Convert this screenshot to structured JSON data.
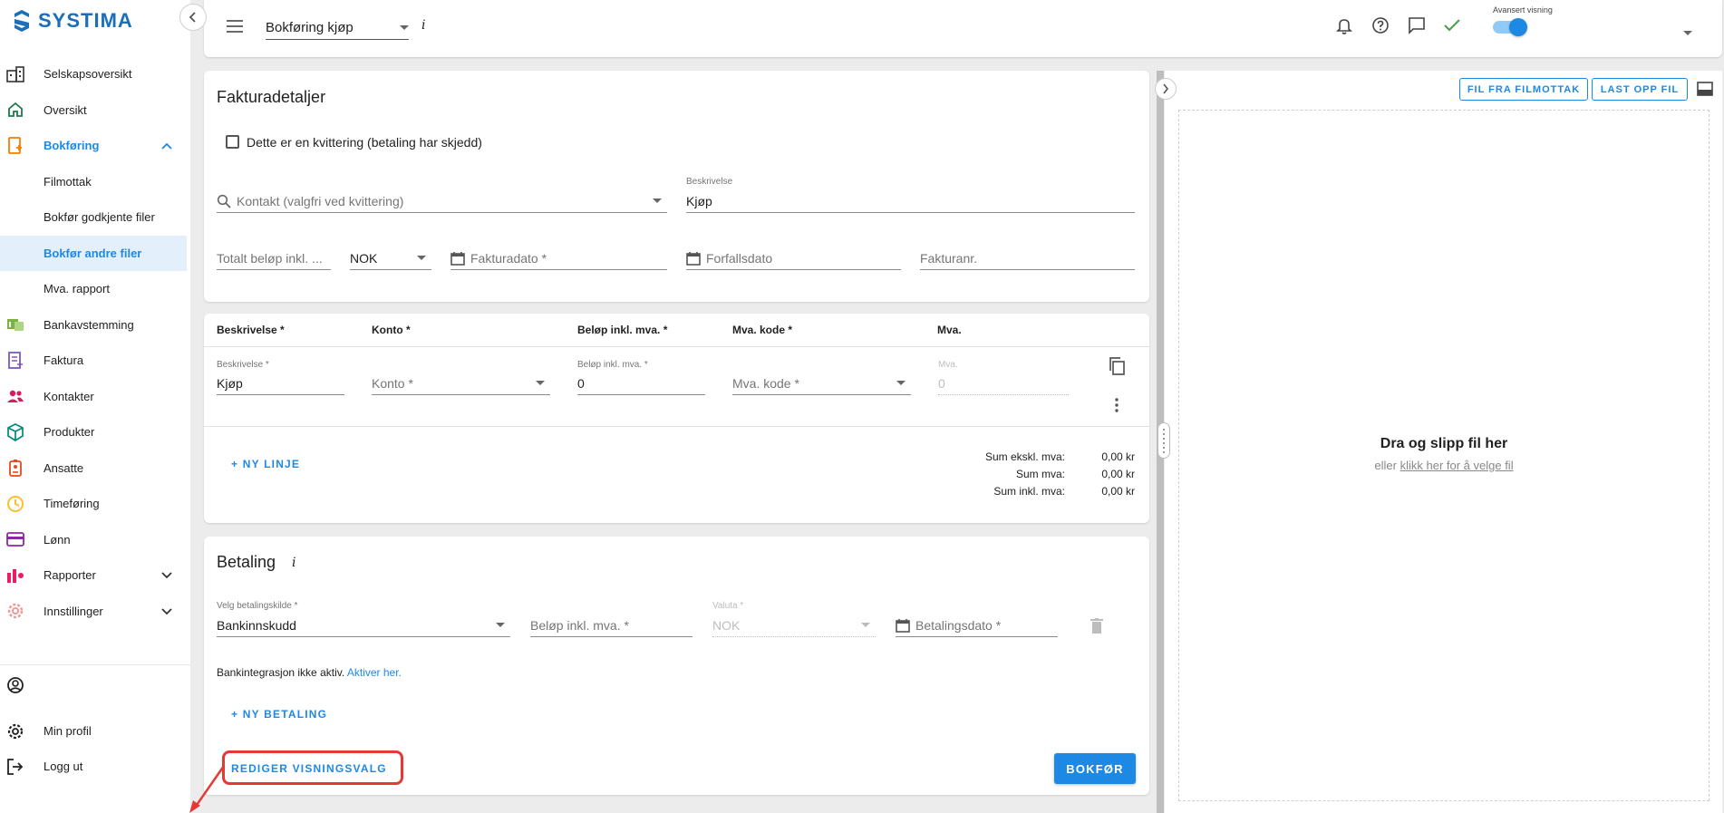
{
  "brand": {
    "name": "SYSTIMA",
    "color": "#1a6fb8"
  },
  "sidebar": {
    "items": [
      {
        "label": "Selskapsoversikt",
        "icon": "company-icon"
      },
      {
        "label": "Oversikt",
        "icon": "home-icon"
      },
      {
        "label": "Bokføring",
        "icon": "bookkeeping-icon",
        "expanded": true
      },
      {
        "label": "Filmottak"
      },
      {
        "label": "Bokfør godkjente filer"
      },
      {
        "label": "Bokfør andre filer",
        "active": true
      },
      {
        "label": "Mva. rapport"
      },
      {
        "label": "Bankavstemming",
        "icon": "bank-icon"
      },
      {
        "label": "Faktura",
        "icon": "invoice-icon"
      },
      {
        "label": "Kontakter",
        "icon": "contacts-icon"
      },
      {
        "label": "Produkter",
        "icon": "product-icon"
      },
      {
        "label": "Ansatte",
        "icon": "employee-icon"
      },
      {
        "label": "Timeføring",
        "icon": "clock-icon"
      },
      {
        "label": "Lønn",
        "icon": "salary-icon"
      },
      {
        "label": "Rapporter",
        "icon": "reports-icon"
      },
      {
        "label": "Innstillinger",
        "icon": "settings-icon"
      }
    ],
    "bottom": [
      {
        "label": "",
        "icon": "account-icon"
      },
      {
        "label": "Min profil",
        "icon": "gear-icon"
      },
      {
        "label": "Logg ut",
        "icon": "logout-icon"
      }
    ]
  },
  "topbar": {
    "title": "Bokføring kjøp",
    "info": "i",
    "advanced_label": "Avansert visning",
    "advanced_on": true
  },
  "details": {
    "title": "Fakturadetaljer",
    "receipt_checkbox": "Dette er en kvittering (betaling har skjedd)",
    "contact_placeholder": "Kontakt (valgfri ved kvittering)",
    "description_label": "Beskrivelse",
    "description_value": "Kjøp",
    "total_placeholder": "Totalt beløp inkl. ...",
    "currency": "NOK",
    "invoice_date": "Fakturadato *",
    "due_date": "Forfallsdato",
    "invoice_no": "Fakturanr."
  },
  "lines": {
    "headers": [
      "Beskrivelse *",
      "Konto *",
      "Beløp inkl. mva. *",
      "Mva. kode *",
      "Mva."
    ],
    "row": {
      "desc_label": "Beskrivelse *",
      "desc_value": "Kjøp",
      "account": "Konto *",
      "amount_label": "Beløp inkl. mva. *",
      "amount_value": "0",
      "vat_code": "Mva. kode *",
      "vat_label": "Mva.",
      "vat_value": "0"
    },
    "new_line": "+ NY LINJE",
    "sums": [
      {
        "label": "Sum ekskl. mva:",
        "value": "0,00 kr"
      },
      {
        "label": "Sum mva:",
        "value": "0,00 kr"
      },
      {
        "label": "Sum inkl. mva:",
        "value": "0,00 kr"
      }
    ]
  },
  "payment": {
    "title": "Betaling",
    "info": "i",
    "source_label": "Velg betalingskilde *",
    "source_value": "Bankinnskudd",
    "amount_placeholder": "Beløp inkl. mva. *",
    "currency_label": "Valuta *",
    "currency_value": "NOK",
    "date_placeholder": "Betalingsdato *",
    "bank_notice": "Bankintegrasjon ikke aktiv.",
    "bank_link": "Aktiver her.",
    "new_payment": "+ NY BETALING"
  },
  "footer": {
    "edit_view": "REDIGER VISNINGSVALG",
    "submit": "BOKFØR"
  },
  "file_panel": {
    "from_inbox": "FIL FRA FILMOTTAK",
    "upload": "LAST OPP FIL",
    "drop_title": "Dra og slipp fil her",
    "drop_or": "eller",
    "drop_link": "klikk her for å velge fil"
  },
  "colors": {
    "accent": "#1e88e5",
    "success": "#43a047",
    "highlight": "#e53935"
  }
}
